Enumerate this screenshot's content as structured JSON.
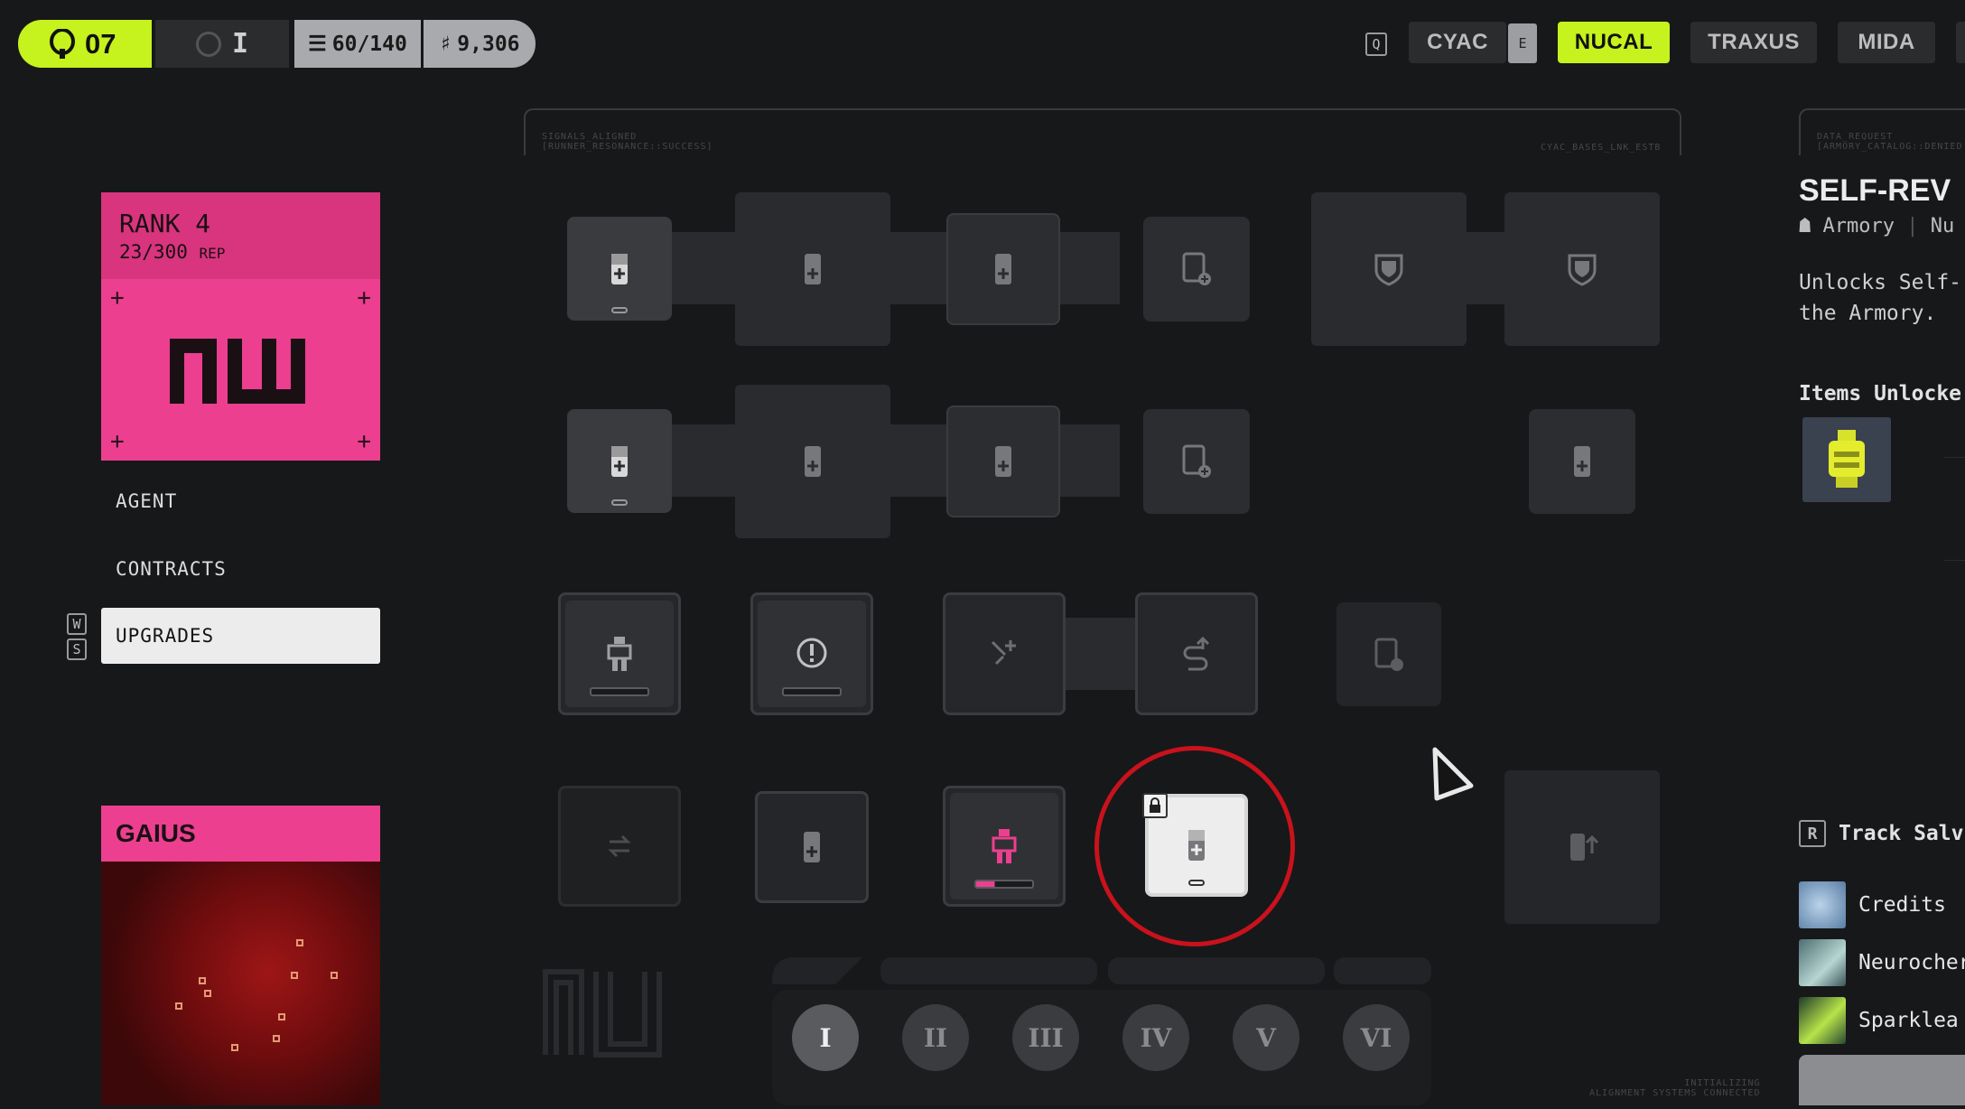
{
  "topbar": {
    "level": "07",
    "ring_label": "I",
    "storage": "60/140",
    "credits": "9,306",
    "key_hint_left": "Q",
    "key_hint_right": "E"
  },
  "factions": [
    {
      "name": "CYAC",
      "active": false
    },
    {
      "name": "NUCAL",
      "active": true
    },
    {
      "name": "TRAXUS",
      "active": false
    },
    {
      "name": "MIDA",
      "active": false
    }
  ],
  "rank_card": {
    "title": "RANK 4",
    "rep_value": "23/300",
    "rep_unit": "REP",
    "logo_text": "nu"
  },
  "menu": {
    "items": [
      "AGENT",
      "CONTRACTS",
      "UPGRADES"
    ],
    "active": "UPGRADES",
    "key_up": "W",
    "key_down": "S"
  },
  "handler": {
    "name": "GAIUS"
  },
  "grid_header": {
    "left_line1": "SIGNALS_ALIGNED",
    "left_line2": "[RUNNER_RESONANCE::SUCCESS]",
    "right": "CYAC_BASES_LNK_ESTB"
  },
  "tiers": [
    "I",
    "II",
    "III",
    "IV",
    "V",
    "VI"
  ],
  "active_tier": "I",
  "footer_text": {
    "line1": "INITIALIZING",
    "line2": "ALIGNMENT SYSTEMS CONNECTED"
  },
  "detail_panel": {
    "header_line1": "DATA_REQUEST",
    "header_line2": "[ARMORY_CATALOG::DENIED",
    "title": "SELF-REV",
    "category": "Armory",
    "category_extra": "Nu",
    "description": "Unlocks Self-\nthe Armory.",
    "items_heading": "Items Unlocke",
    "track_key": "R",
    "track_label": "Track Salv",
    "resources": [
      "Credits",
      "Neurocher",
      "Sparklea"
    ]
  },
  "colors": {
    "accent": "#c6f21d",
    "nucal_pink": "#ec3f8f",
    "selection_ring": "#c8121c",
    "background": "#17181a"
  }
}
